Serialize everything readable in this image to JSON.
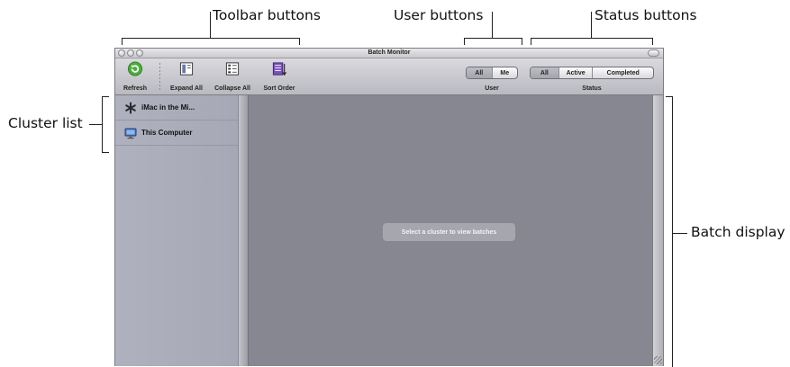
{
  "annotations": {
    "toolbar_buttons": "Toolbar buttons",
    "user_buttons": "User buttons",
    "status_buttons": "Status buttons",
    "cluster_list": "Cluster list",
    "batch_display": "Batch display"
  },
  "window": {
    "title": "Batch Monitor"
  },
  "toolbar": {
    "refresh": "Refresh",
    "expand_all": "Expand All",
    "collapse_all": "Collapse All",
    "sort_order": "Sort Order"
  },
  "user_filter": {
    "caption": "User",
    "options": [
      "All",
      "Me"
    ],
    "selected": "All"
  },
  "status_filter": {
    "caption": "Status",
    "options": [
      "All",
      "Active",
      "Completed"
    ],
    "selected": "All"
  },
  "clusters": [
    {
      "label": "iMac in the Mi...",
      "icon": "cluster-asterisk-icon"
    },
    {
      "label": "This Computer",
      "icon": "computer-monitor-icon"
    }
  ],
  "main": {
    "message": "Select a cluster to view batches"
  },
  "colors": {
    "window_bg": "#8e8e98",
    "sidebar_bg": "#abadbb",
    "refresh_green": "#4caf3a",
    "sort_purple": "#7a4fc0"
  }
}
